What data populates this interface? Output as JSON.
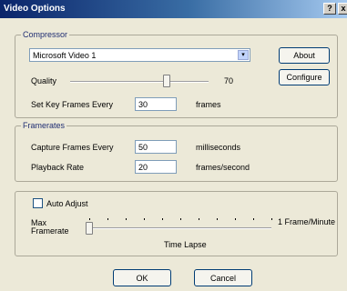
{
  "window": {
    "title": "Video Options",
    "help_glyph": "?",
    "close_glyph": "x"
  },
  "compressor": {
    "group_label": "Compressor",
    "selected": "Microsoft Video 1",
    "dropdown_glyph": "▾",
    "about_label": "About",
    "configure_label": "Configure",
    "quality_label": "Quality",
    "quality_value": "70",
    "quality_level": 0.7,
    "keyframes_label": "Set Key Frames Every",
    "keyframes_value": "30",
    "keyframes_unit": "frames"
  },
  "framerates": {
    "group_label": "Framerates",
    "capture_label": "Capture Frames Every",
    "capture_value": "50",
    "capture_unit": "milliseconds",
    "playback_label": "Playback Rate",
    "playback_value": "20",
    "playback_unit": "frames/second"
  },
  "timelapse": {
    "auto_adjust_label": "Auto Adjust",
    "auto_adjust_checked": false,
    "max_framerate_label_line1": "Max",
    "max_framerate_label_line2": "Framerate",
    "max_value": "1 Frame/Minute",
    "caption": "Time Lapse"
  },
  "buttons": {
    "ok_label": "OK",
    "cancel_label": "Cancel"
  }
}
